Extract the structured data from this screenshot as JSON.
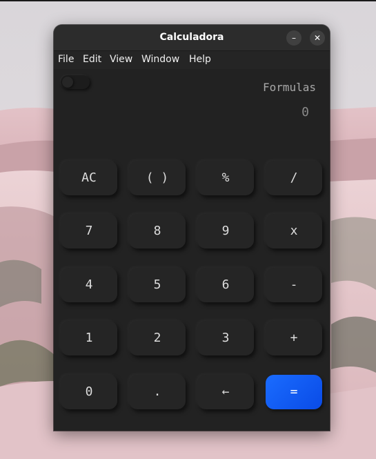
{
  "window": {
    "title": "Calculadora",
    "minimize_glyph": "–",
    "close_glyph": "✕"
  },
  "menubar": {
    "items": [
      "File",
      "Edit",
      "View",
      "Window",
      "Help"
    ]
  },
  "display": {
    "formulas_label": "Formulas",
    "result": "0"
  },
  "keypad": {
    "rows": [
      [
        "AC",
        "( )",
        "%",
        "/"
      ],
      [
        "7",
        "8",
        "9",
        "x"
      ],
      [
        "4",
        "5",
        "6",
        "-"
      ],
      [
        "1",
        "2",
        "3",
        "+"
      ],
      [
        "0",
        ".",
        "←",
        "="
      ]
    ]
  },
  "colors": {
    "accent": "#1a6cff",
    "window_bg": "#222222",
    "key_bg": "#252525"
  }
}
